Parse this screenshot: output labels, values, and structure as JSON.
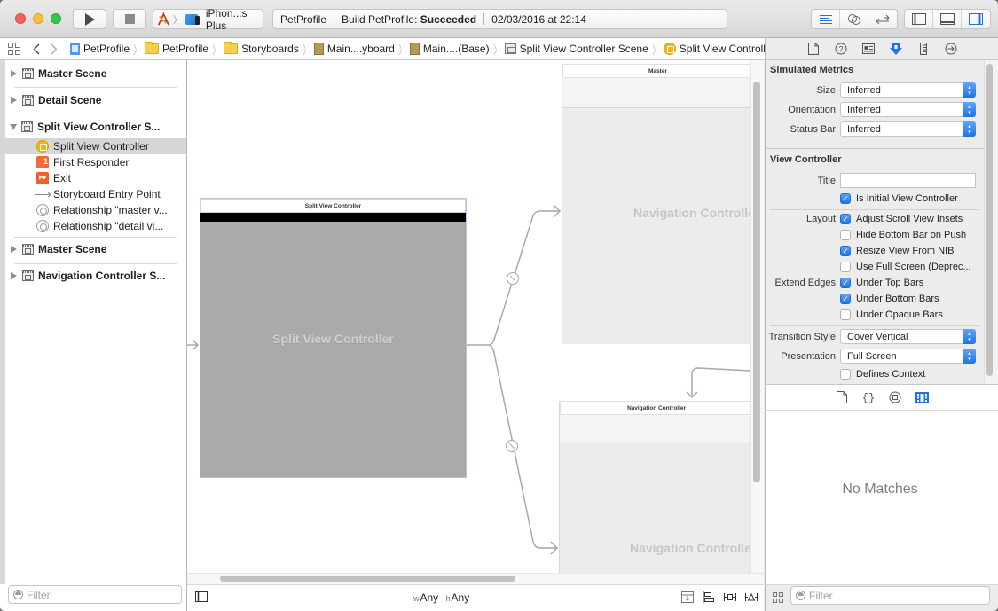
{
  "window": {
    "scheme": {
      "target_icon": "xcode-app-icon",
      "device": "iPhon...s Plus"
    },
    "activity": {
      "project": "PetProfile",
      "build_prefix": "Build PetProfile:",
      "build_status": "Succeeded",
      "timestamp": "02/03/2016 at 22:14"
    },
    "toolbar_buttons": [
      "run",
      "stop"
    ],
    "editor_modes": [
      "standard-editor",
      "assistant-editor",
      "version-editor"
    ],
    "view_toggles": [
      "navigator",
      "debug-area",
      "utilities"
    ]
  },
  "jumpbar": {
    "crumbs": [
      {
        "label": "PetProfile",
        "icon": "project-icon"
      },
      {
        "label": "PetProfile",
        "icon": "folder-icon"
      },
      {
        "label": "Storyboards",
        "icon": "folder-icon"
      },
      {
        "label": "Main....yboard",
        "icon": "storyboard-file-icon"
      },
      {
        "label": "Main....(Base)",
        "icon": "storyboard-file-icon"
      },
      {
        "label": "Split View Controller Scene",
        "icon": "scene-icon"
      },
      {
        "label": "Split View Controller",
        "icon": "split-view-controller-icon"
      }
    ]
  },
  "outline": {
    "items": [
      {
        "label": "Master Scene",
        "type": "scene",
        "expanded": false
      },
      {
        "label": "Detail Scene",
        "type": "scene",
        "expanded": false
      },
      {
        "label": "Split View Controller S...",
        "type": "scene",
        "expanded": true
      },
      {
        "label": "Split View Controller",
        "type": "child",
        "icon": "split-view-controller-icon",
        "selected": true
      },
      {
        "label": "First Responder",
        "type": "child",
        "icon": "first-responder-icon"
      },
      {
        "label": "Exit",
        "type": "child",
        "icon": "exit-icon"
      },
      {
        "label": "Storyboard Entry Point",
        "type": "child",
        "icon": "arrow-icon"
      },
      {
        "label": "Relationship \"master v...",
        "type": "child",
        "icon": "relationship-icon"
      },
      {
        "label": "Relationship \"detail vi...",
        "type": "child",
        "icon": "relationship-icon"
      },
      {
        "label": "Master Scene",
        "type": "scene",
        "expanded": false
      },
      {
        "label": "Navigation Controller S...",
        "type": "scene",
        "expanded": false
      }
    ],
    "filter_placeholder": "Filter"
  },
  "canvas": {
    "split_view": {
      "title": "Split View Controller",
      "watermark": "Split View Controller"
    },
    "nav_top": {
      "title": "Master",
      "watermark": "Navigation Controlle"
    },
    "nav_bottom": {
      "title": "Navigation Controller",
      "watermark": "Navigation Controlle"
    },
    "size_class": {
      "w_prefix": "w",
      "w_value": "Any",
      "h_prefix": "h",
      "h_value": "Any"
    }
  },
  "inspector": {
    "tabs": [
      "file-inspector",
      "quick-help",
      "identity-inspector",
      "attributes-inspector",
      "size-inspector",
      "connections-inspector"
    ],
    "active_tab": "attributes-inspector",
    "simulated_metrics": {
      "title": "Simulated Metrics",
      "size_label": "Size",
      "size_value": "Inferred",
      "orientation_label": "Orientation",
      "orientation_value": "Inferred",
      "status_bar_label": "Status Bar",
      "status_bar_value": "Inferred"
    },
    "view_controller": {
      "title": "View Controller",
      "title_label": "Title",
      "title_value": "",
      "is_initial": {
        "label": "Is Initial View Controller",
        "checked": true
      },
      "layout_label": "Layout",
      "layout": [
        {
          "label": "Adjust Scroll View Insets",
          "checked": true
        },
        {
          "label": "Hide Bottom Bar on Push",
          "checked": false
        },
        {
          "label": "Resize View From NIB",
          "checked": true
        },
        {
          "label": "Use Full Screen (Deprec...",
          "checked": false
        }
      ],
      "extend_edges_label": "Extend Edges",
      "extend_edges": [
        {
          "label": "Under Top Bars",
          "checked": true
        },
        {
          "label": "Under Bottom Bars",
          "checked": true
        },
        {
          "label": "Under Opaque Bars",
          "checked": false
        }
      ],
      "transition_style_label": "Transition Style",
      "transition_style_value": "Cover Vertical",
      "presentation_label": "Presentation",
      "presentation_value": "Full Screen",
      "defines_context": {
        "label": "Defines Context",
        "checked": false
      }
    }
  },
  "library": {
    "tabs": [
      "file-template-library",
      "code-snippet-library",
      "object-library",
      "media-library"
    ],
    "active_tab": "media-library",
    "empty_text": "No Matches",
    "filter_placeholder": "Filter"
  },
  "colors": {
    "accent": "#1f74e7",
    "selection": "#d6d6d6",
    "scene_yellow": "#f6b600",
    "exit_orange": "#ee5f2b"
  }
}
